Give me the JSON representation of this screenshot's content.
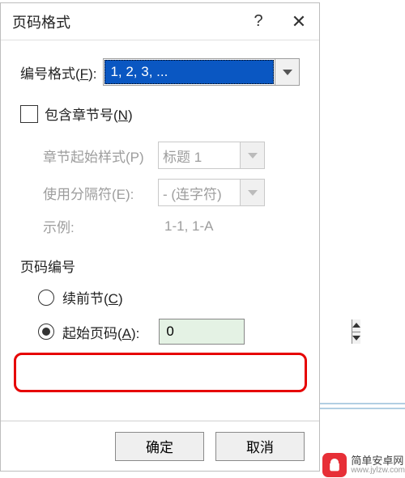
{
  "dialog": {
    "title": "页码格式",
    "help_char": "?",
    "close_char": "✕"
  },
  "format_row": {
    "label_pre": "编号格式(",
    "label_key": "F",
    "label_post": "):",
    "value": "1, 2, 3, ..."
  },
  "include_chapter": {
    "label_pre": "包含章节号(",
    "label_key": "N",
    "label_post": ")",
    "checked": false
  },
  "chapter": {
    "start_style_label": "章节起始样式(P)",
    "start_style_value": "标题 1",
    "separator_label": "使用分隔符(E):",
    "separator_value": "-   (连字符)",
    "example_label": "示例:",
    "example_value": "1-1, 1-A"
  },
  "page_number": {
    "section_title": "页码编号",
    "continue_label_pre": "续前节(",
    "continue_key": "C",
    "continue_label_post": ")",
    "start_label_pre": "起始页码(",
    "start_key": "A",
    "start_label_post": "):",
    "start_value": "0",
    "selected": "start"
  },
  "buttons": {
    "ok": "确定",
    "cancel": "取消"
  },
  "watermark": {
    "name": "简单安卓网",
    "url": "www.jylzw.com"
  }
}
